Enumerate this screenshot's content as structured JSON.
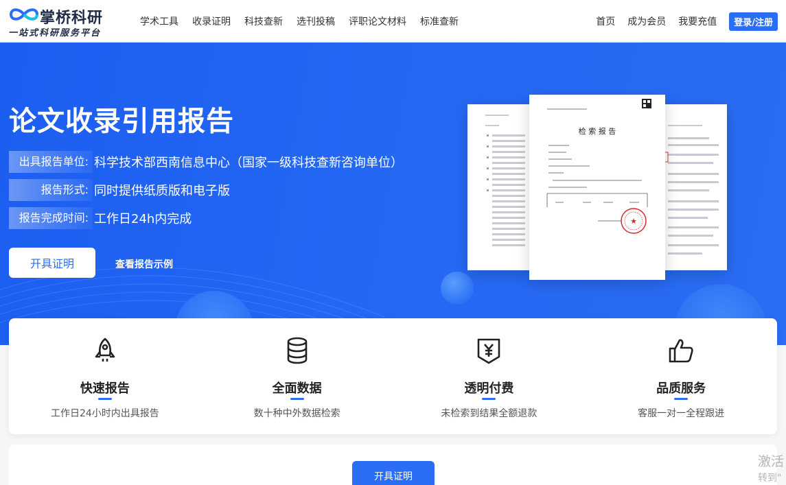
{
  "brand": {
    "name": "掌桥科研",
    "slogan": "一站式科研服务平台"
  },
  "nav": {
    "items": [
      "学术工具",
      "收录证明",
      "科技查新",
      "选刊投稿",
      "评职论文材料",
      "标准查新"
    ],
    "right_items": [
      "首页",
      "成为会员",
      "我要充值"
    ],
    "login_label": "登录/注册"
  },
  "hero": {
    "title": "论文收录引用报告",
    "rows": [
      {
        "label": "出具报告单位:",
        "value": "科学技术部西南信息中心（国家一级科技查新咨询单位）"
      },
      {
        "label": "报告形式:",
        "value": "同时提供纸质版和电子版"
      },
      {
        "label": "报告完成时间:",
        "value": "工作日24h内完成"
      }
    ],
    "button_label": "开具证明",
    "link_label": "查看报告示例",
    "doc_title": "检 索 报 告"
  },
  "features": [
    {
      "icon": "rocket-icon",
      "title": "快速报告",
      "desc": "工作日24小时内出具报告"
    },
    {
      "icon": "database-icon",
      "title": "全面数据",
      "desc": "数十种中外数据检索"
    },
    {
      "icon": "yen-shield-icon",
      "title": "透明付费",
      "desc": "未检索到结果全额退款"
    },
    {
      "icon": "thumbs-up-icon",
      "title": "品质服务",
      "desc": "客服一对一全程跟进"
    }
  ],
  "bottom": {
    "button_label": "开具证明"
  },
  "watermark": {
    "line1": "激活",
    "line2": "转到\""
  },
  "colors": {
    "accent": "#2b6ef5",
    "hero_bg": "#2467f3"
  }
}
